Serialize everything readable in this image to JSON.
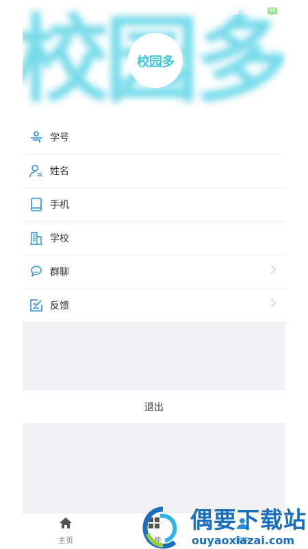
{
  "header": {
    "background_text": "校园多",
    "logo_text": "校园多",
    "battery": "98",
    "accent_color": "#3ec7dc"
  },
  "menu": [
    {
      "label": "学号",
      "icon": "student-id-icon",
      "has_arrow": false
    },
    {
      "label": "姓名",
      "icon": "person-icon",
      "has_arrow": false
    },
    {
      "label": "手机",
      "icon": "phone-icon",
      "has_arrow": false
    },
    {
      "label": "学校",
      "icon": "school-building-icon",
      "has_arrow": false
    },
    {
      "label": "群聊",
      "icon": "group-chat-icon",
      "has_arrow": true
    },
    {
      "label": "反馈",
      "icon": "feedback-edit-icon",
      "has_arrow": true
    }
  ],
  "logout_label": "退出",
  "tabs": [
    {
      "label": "主页",
      "icon": "home-icon"
    },
    {
      "label": "功能",
      "icon": "grid-icon"
    },
    {
      "label": "我的",
      "icon": "user-icon",
      "active": true
    }
  ],
  "watermark": {
    "name": "偶要下载站",
    "url": "ouyaoxiazai.com"
  },
  "colors": {
    "icon_blue": "#2b8fd9",
    "separator": "#ececec",
    "gap_bg": "#f2f1f4"
  }
}
